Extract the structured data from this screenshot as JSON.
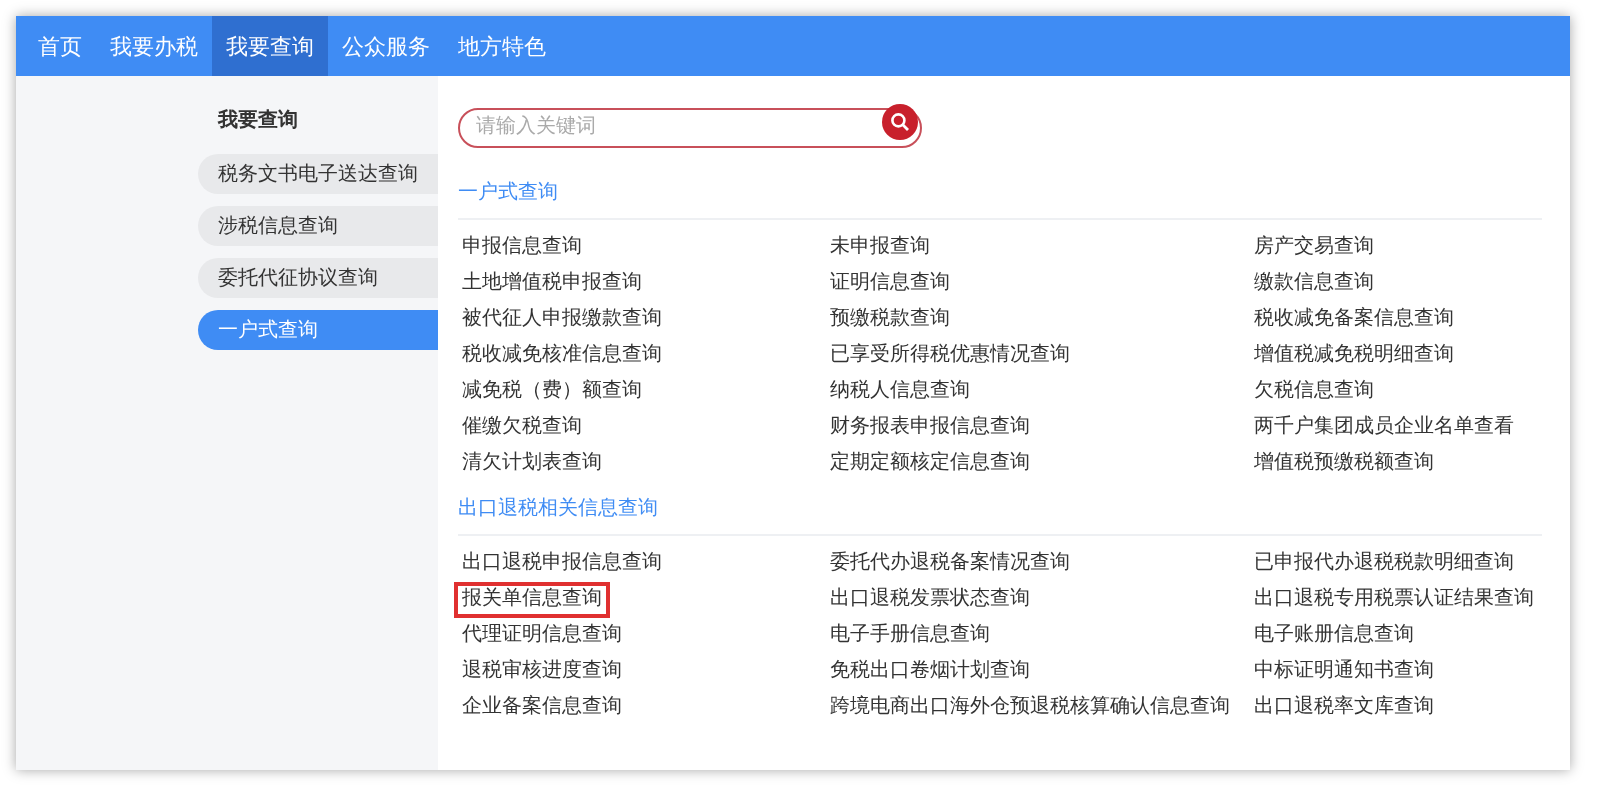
{
  "nav": [
    {
      "label": "首页",
      "selected": false
    },
    {
      "label": "我要办税",
      "selected": false
    },
    {
      "label": "我要查询",
      "selected": true
    },
    {
      "label": "公众服务",
      "selected": false
    },
    {
      "label": "地方特色",
      "selected": false
    }
  ],
  "sidebar": {
    "title": "我要查询",
    "items": [
      {
        "label": "税务文书电子送达查询",
        "selected": false
      },
      {
        "label": "涉税信息查询",
        "selected": false
      },
      {
        "label": "委托代征协议查询",
        "selected": false
      },
      {
        "label": "一户式查询",
        "selected": true
      }
    ]
  },
  "search": {
    "placeholder": "请输入关键词"
  },
  "sections": [
    {
      "title": "一户式查询",
      "items": [
        {
          "label": "申报信息查询",
          "highlighted": false
        },
        {
          "label": "未申报查询",
          "highlighted": false
        },
        {
          "label": "房产交易查询",
          "highlighted": false
        },
        {
          "label": "土地增值税申报查询",
          "highlighted": false
        },
        {
          "label": "证明信息查询",
          "highlighted": false
        },
        {
          "label": "缴款信息查询",
          "highlighted": false
        },
        {
          "label": "被代征人申报缴款查询",
          "highlighted": false
        },
        {
          "label": "预缴税款查询",
          "highlighted": false
        },
        {
          "label": "税收减免备案信息查询",
          "highlighted": false
        },
        {
          "label": "税收减免核准信息查询",
          "highlighted": false
        },
        {
          "label": "已享受所得税优惠情况查询",
          "highlighted": false
        },
        {
          "label": "增值税减免税明细查询",
          "highlighted": false
        },
        {
          "label": "减免税（费）额查询",
          "highlighted": false
        },
        {
          "label": "纳税人信息查询",
          "highlighted": false
        },
        {
          "label": "欠税信息查询",
          "highlighted": false
        },
        {
          "label": "催缴欠税查询",
          "highlighted": false
        },
        {
          "label": "财务报表申报信息查询",
          "highlighted": false
        },
        {
          "label": "两千户集团成员企业名单查看",
          "highlighted": false
        },
        {
          "label": "清欠计划表查询",
          "highlighted": false
        },
        {
          "label": "定期定额核定信息查询",
          "highlighted": false
        },
        {
          "label": "增值税预缴税额查询",
          "highlighted": false
        }
      ]
    },
    {
      "title": "出口退税相关信息查询",
      "items": [
        {
          "label": "出口退税申报信息查询",
          "highlighted": false
        },
        {
          "label": "委托代办退税备案情况查询",
          "highlighted": false
        },
        {
          "label": "已申报代办退税税款明细查询",
          "highlighted": false
        },
        {
          "label": "报关单信息查询",
          "highlighted": true
        },
        {
          "label": "出口退税发票状态查询",
          "highlighted": false
        },
        {
          "label": "出口退税专用税票认证结果查询",
          "highlighted": false
        },
        {
          "label": "代理证明信息查询",
          "highlighted": false
        },
        {
          "label": "电子手册信息查询",
          "highlighted": false
        },
        {
          "label": "电子账册信息查询",
          "highlighted": false
        },
        {
          "label": "退税审核进度查询",
          "highlighted": false
        },
        {
          "label": "免税出口卷烟计划查询",
          "highlighted": false
        },
        {
          "label": "中标证明通知书查询",
          "highlighted": false
        },
        {
          "label": "企业备案信息查询",
          "highlighted": false
        },
        {
          "label": "跨境电商出口海外仓预退税核算确认信息查询",
          "highlighted": false
        },
        {
          "label": "出口退税率文库查询",
          "highlighted": false
        }
      ]
    }
  ]
}
